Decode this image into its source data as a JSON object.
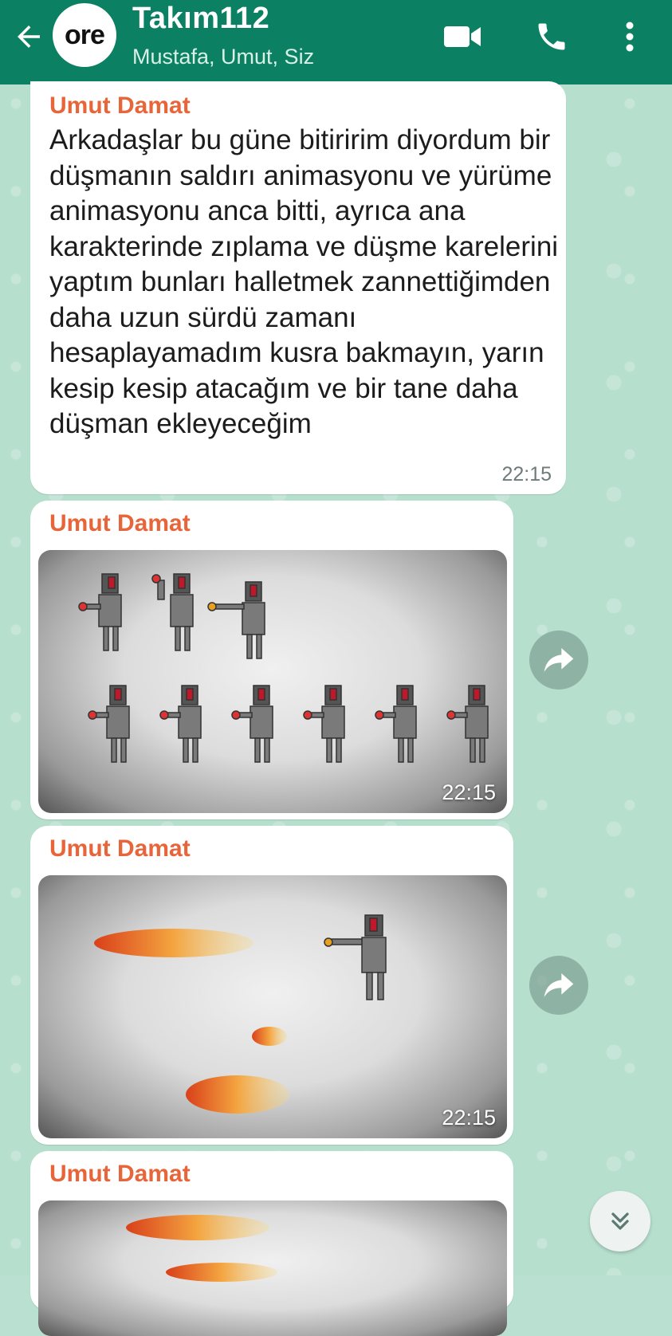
{
  "header": {
    "avatar_text": "ore",
    "title": "Takım112",
    "subtitle": "Mustafa, Umut, Siz"
  },
  "messages": [
    {
      "sender": "Umut Damat",
      "text": "Arkadaşlar bu güne bitiririm diyordum bir düşmanın saldırı animasyonu ve yürüme animasyonu anca bitti, ayrıca ana karakterinde zıplama ve düşme karelerini yaptım bunları halletmek zannettiğimden daha uzun sürdü zamanı hesaplayamadım kusra bakmayın, yarın kesip kesip atacağım ve bir tane daha düşman ekleyeceğim",
      "time": "22:15"
    },
    {
      "sender": "Umut Damat",
      "type": "image",
      "time": "22:15"
    },
    {
      "sender": "Umut Damat",
      "type": "image",
      "time": "22:15"
    },
    {
      "sender": "Umut Damat",
      "type": "image"
    }
  ],
  "icons": {
    "back": "arrow-left-icon",
    "video": "video-camera-icon",
    "call": "phone-icon",
    "menu": "more-vertical-icon",
    "forward": "share-forward-icon",
    "scroll": "double-chevron-down-icon"
  },
  "colors": {
    "header": "#0c8062",
    "sender": "#e8653a",
    "chat_background": "#b7dfce"
  }
}
